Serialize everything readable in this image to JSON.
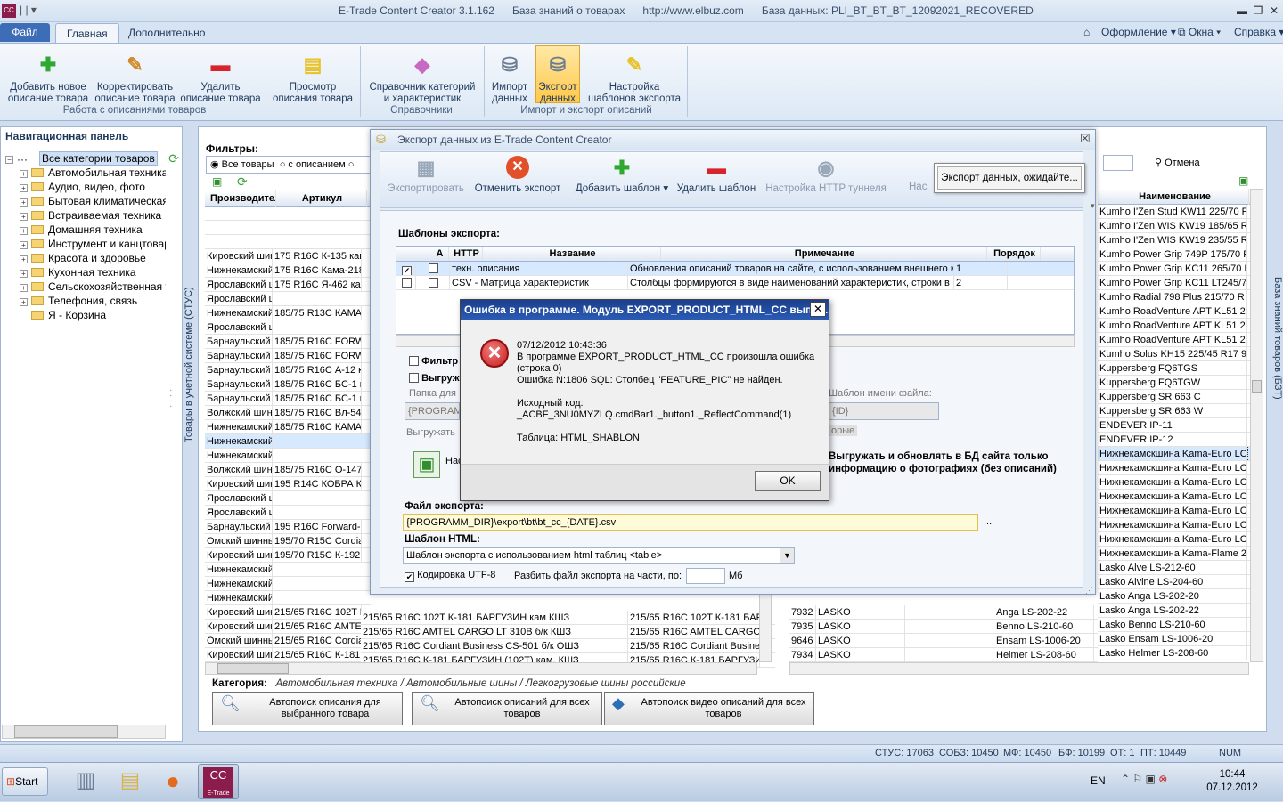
{
  "app": {
    "title": "E-Trade Content Creator 3.1.162",
    "kb": "База знаний о товарах",
    "url": "http://www.elbuz.com",
    "db": "База данных: PLI_BT_BT_BT_12092021_RECOVERED",
    "icon": "CC"
  },
  "tabs": {
    "file": "Файл",
    "home": "Главная",
    "more": "Дополнительно"
  },
  "topright": {
    "design": "Оформление",
    "window": "Окна",
    "help": "Справка"
  },
  "ribbon": {
    "add": "Добавить новое\nописание товара",
    "edit": "Корректировать\nописание товара",
    "del": "Удалить\nописание товара",
    "view": "Просмотр\nописания товара",
    "dict": "Справочник категорий\nи характеристик",
    "import": "Импорт\nданных",
    "export": "Экспорт\nданных",
    "tpl": "Настройка\nшаблонов экспорта",
    "g1": "Работа с описаниями товаров",
    "g2": "Справочники",
    "g3": "Импорт и экспорт описаний"
  },
  "nav": {
    "title": "Навигационная панель",
    "root": "Все категории товаров",
    "items": [
      "Автомобильная техника",
      "Аудио, видео, фото",
      "Бытовая климатическая техника",
      "Встраиваемая техника",
      "Домашняя техника",
      "Инструмент и канцтовары",
      "Красота и здоровье",
      "Кухонная техника",
      "Сельскохозяйственная техника",
      "Телефония, связь",
      "Я - Корзина"
    ]
  },
  "main": {
    "filters": "Фильтры:",
    "all": "Все товары",
    "withdesc": "с описанием",
    "vlabel": "Товары в учетной системе (СТУС)",
    "vlabel2": "База знаний товаров (БЗТ)",
    "col_maker": "Производитель",
    "col_art": "Артикул",
    "col_name": "Наименование",
    "cancel": "Отмена",
    "left_rows": [
      [
        "",
        ""
      ],
      [
        "",
        ""
      ],
      [
        "",
        ""
      ],
      [
        "Кировский шин",
        "175 R16C К-135 кам"
      ],
      [
        "Нижнекамский",
        "175 R16C Кама-218"
      ],
      [
        "Ярославский ш",
        "175 R16C Я-462 кам"
      ],
      [
        "Ярославский ш",
        ""
      ],
      [
        "Нижнекамский",
        "185/75 R13C КАМА-"
      ],
      [
        "Ярославский ш",
        ""
      ],
      [
        "Барнаульский",
        "185/75 R16C FORW"
      ],
      [
        "Барнаульский",
        "185/75 R16C FORW"
      ],
      [
        "Барнаульский",
        "185/75 R16C А-12 к"
      ],
      [
        "Барнаульский",
        "185/75 R16C БС-1 к"
      ],
      [
        "Барнаульский",
        "185/75 R16C БС-1 к"
      ],
      [
        "Волжский шин",
        "185/75 R16C Вл-54 к"
      ],
      [
        "Нижнекамский",
        "185/75 R16C КАМА-"
      ],
      [
        "Нижнекамский",
        ""
      ],
      [
        "Нижнекамский",
        ""
      ],
      [
        "Волжский шин",
        "185/75 R16C О-147"
      ],
      [
        "Кировский шин",
        "195 R14C КОБРА К-"
      ],
      [
        "Ярославский ш",
        ""
      ],
      [
        "Ярославский ш",
        ""
      ],
      [
        "Барнаульский",
        "195 R16C Forward-1"
      ],
      [
        "Омский шинны",
        "195/70 R15C Cordia"
      ],
      [
        "Кировский шин",
        "195/70 R15C К-192"
      ],
      [
        "Нижнекамский",
        ""
      ],
      [
        "Нижнекамский",
        ""
      ],
      [
        "Нижнекамский",
        ""
      ],
      [
        "Кировский шин",
        "215/65 R16C 102T K"
      ],
      [
        "Кировский шин",
        "215/65 R16C AMTEL"
      ],
      [
        "Омский шинны",
        "215/65 R16C Cordia"
      ],
      [
        "Кировский шин",
        "215/65 R16C К-181"
      ]
    ],
    "mid_rows": [
      [
        "215/65 R16C 102T К-181 БАРГУЗИН кам КШЗ",
        "215/65 R16C 102T К-181 БАР"
      ],
      [
        "215/65 R16C AMTEL CARGO LT 310B б/к КШЗ",
        "215/65 R16C AMTEL CARGO L"
      ],
      [
        "215/65 R16C Cordiant Business CS-501 б/к ОШЗ",
        "215/65 R16C Cordiant Busine"
      ],
      [
        "215/65 R16C К-181 БАРГУЗИН (102T) кам. КШЗ",
        "215/65 R16C К-181 БАРГУЗИ"
      ]
    ],
    "right_rows": [
      "Kumho I'Zen Stud KW11 225/70 R",
      "Kumho I'Zen WIS KW19 185/65 R",
      "Kumho I'Zen WIS KW19 235/55 R",
      "Kumho Power Grip 749P 175/70 R",
      "Kumho Power Grip KC11 265/70 R",
      "Kumho Power Grip KC11 LT245/7",
      "Kumho Radial 798 Plus 215/70 R",
      "Kumho RoadVenture APT KL51 21",
      "Kumho RoadVenture APT KL51 22",
      "Kumho RoadVenture APT KL51 22",
      "Kumho Solus KH15 225/45 R17 9",
      "Kuppersberg FQ6TGS",
      "Kuppersberg FQ6TGW",
      "Kuppersberg SR 663 C",
      "Kuppersberg SR 663 W",
      "ENDEVER IP-11",
      "ENDEVER IP-12",
      "Нижнекамскшина Kama-Euro LC",
      "Нижнекамскшина Kama-Euro LC",
      "Нижнекамскшина Kama-Euro LC",
      "Нижнекамскшина Kama-Euro LC",
      "Нижнекамскшина Kama-Euro LC",
      "Нижнекамскшина Kama-Euro LC",
      "Нижнекамскшина Kama-Euro LC",
      "Нижнекамскшина Kama-Flame 20",
      "Lasko Alve LS-212-60",
      "Lasko Alvine LS-204-60",
      "Lasko Anga LS-202-20",
      "Lasko Anga LS-202-22",
      "Lasko Benno LS-210-60",
      "Lasko Ensam LS-1006-20",
      "Lasko Helmer LS-208-60"
    ],
    "right_marks": [
      "0",
      "0",
      "0",
      "0",
      "0",
      "5/",
      "R",
      "2",
      "2",
      "2",
      "0",
      "",
      "",
      "",
      "",
      "",
      "",
      "5/",
      "5/",
      "5/",
      "5/",
      "5/",
      "5/",
      "5/",
      "5/",
      "",
      "",
      "",
      "",
      "",
      "",
      ""
    ],
    "lasko_rows": [
      [
        "7932",
        "LASKO",
        "Anga LS-202-22"
      ],
      [
        "7935",
        "LASKO",
        "Benno LS-210-60"
      ],
      [
        "9646",
        "LASKO",
        "Ensam LS-1006-20"
      ],
      [
        "7934",
        "LASKO",
        "Helmer LS-208-60"
      ]
    ],
    "category_label": "Категория:",
    "category": "Автомобильная техника / Автомобильные шины / Легкогрузовые шины российские",
    "auto1": "Автопоиск описания для\nвыбранного товара",
    "auto2": "Автопоиск описаний для всех\nтоваров",
    "auto3": "Автопоиск видео описаний для всех\nтоваров"
  },
  "export": {
    "title": "Экспорт данных из E-Trade Content Creator",
    "do": "Экспортировать",
    "cancel": "Отменить экспорт",
    "addtpl": "Добавить шаблон",
    "deltpl": "Удалить шаблон",
    "http": "Настройка HTTP туннеля",
    "more": "Нас",
    "wait": "Экспорт данных, ожидайте...",
    "tpl_label": "Шаблоны экспорта:",
    "cols": {
      "a": "A",
      "http": "HTTP",
      "name": "Название",
      "note": "Примечание",
      "order": "Порядок"
    },
    "rows": [
      {
        "name": "техн. описания",
        "note": "Обновления описаний товаров на сайте, с использованием внешнего м",
        "order": "1"
      },
      {
        "name": "CSV - Матрица характеристик",
        "note": "Столбцы формируются в виде наименований характеристик, строки в",
        "order": "2"
      }
    ],
    "filter": "Фильтр",
    "upload": "Выгруж",
    "folder": "Папка для",
    "prog": "{PROGRAMM",
    "unload": "Выгружать",
    "tplname": "Шаблон имени файла:",
    "id": "{ID}",
    "ory": "орые",
    "ns": "Нас",
    "bold": "Выгружать и обновлять в БД сайта только\nинформацию о фотографиях (без описаний)",
    "file_label": "Файл экспорта:",
    "file": "{PROGRAMM_DIR}\\export\\bt\\bt_cc_{DATE}.csv",
    "dots": "...",
    "html_label": "Шаблон HTML:",
    "html": "Шаблон экспорта с использованием html таблиц <table>",
    "utf": "Кодировка UTF-8",
    "split": "Разбить файл экспорта на части, по:",
    "mb": "Мб"
  },
  "error": {
    "title": "Ошибка в программе. Модуль EXPORT_PRODUCT_HTML_CC выпол...",
    "text": "07/12/2012 10:43:36\nВ программе EXPORT_PRODUCT_HTML_CC произошла ошибка\n(строка 0)\nОшибка N:1806 SQL: Столбец \"FEATURE_PIC\" не найден.\n\nИсходный код:\n_ACBF_3NU0MYZLQ.cmdBar1._button1._ReflectCommand(1)\n\nТаблица: HTML_SHABLON",
    "ok": "OK"
  },
  "status": {
    "stus": "СТУС: 17063",
    "sobz": "СОБЗ: 10450",
    "mf": "МФ: 10450",
    "bf": "БФ: 10199",
    "ot": "ОТ: 1",
    "pt": "ПТ: 10449",
    "num": "NUM"
  },
  "taskbar": {
    "start": "Start",
    "lang": "EN",
    "time": "10:44",
    "date": "07.12.2012",
    "cc": "CC",
    "etrade": "E-Trade"
  }
}
